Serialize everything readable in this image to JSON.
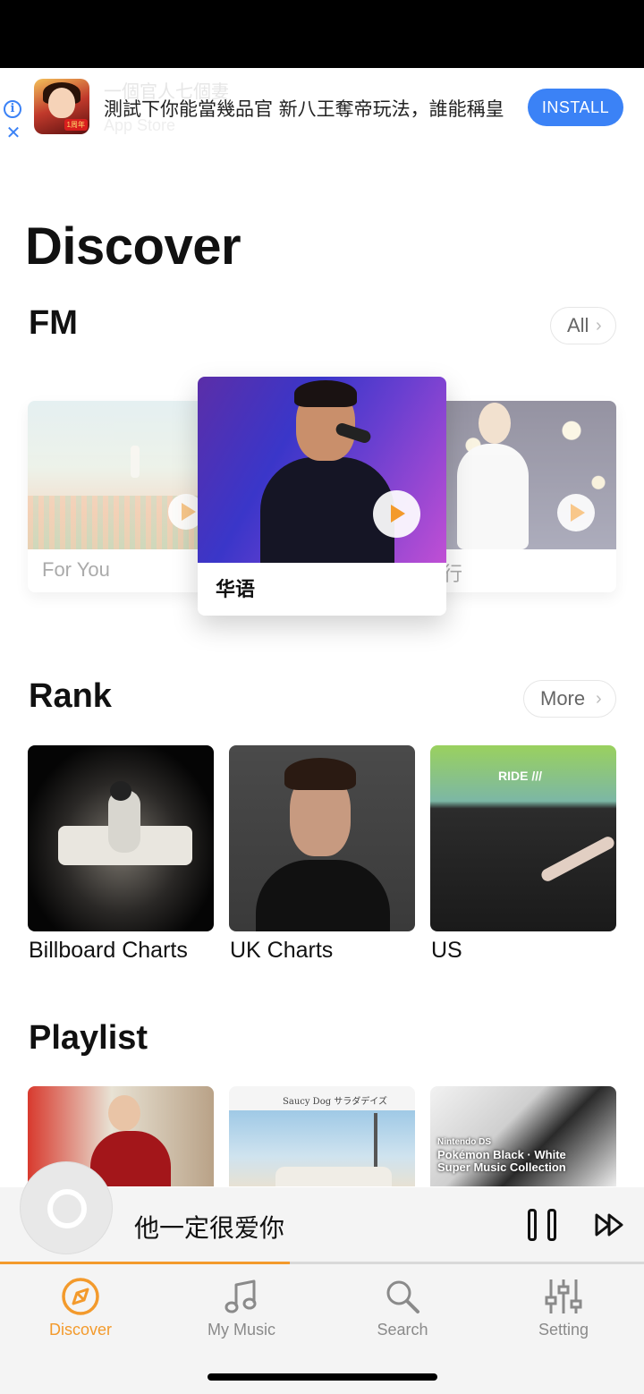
{
  "ad": {
    "ghost_title": "一個官人七個妻",
    "ghost_sub": "App Store",
    "text": "測試下你能當幾品官 新八王奪帝玩法，誰能稱皇",
    "install_label": "INSTALL",
    "thumb_tag": "1周年",
    "info_glyph": "i",
    "close_glyph": "✕"
  },
  "page": {
    "title": "Discover"
  },
  "fm": {
    "title": "FM",
    "all_label": "All",
    "cards": [
      {
        "label": "For You"
      },
      {
        "label": "华语"
      },
      {
        "label": "行"
      }
    ]
  },
  "rank": {
    "title": "Rank",
    "more_label": "More",
    "items": [
      {
        "label": "Billboard Charts"
      },
      {
        "label": "UK Charts"
      },
      {
        "label": "US"
      }
    ],
    "us_cover_title": "RIDE ///"
  },
  "playlist": {
    "title": "Playlist",
    "covers": [
      {
        "caption": ""
      },
      {
        "caption": "Saucy Dog  サラダデイズ"
      },
      {
        "caption_line1": "Nintendo DS",
        "caption_line2": "Pokémon Black · White",
        "caption_line3": "Super Music Collection"
      }
    ]
  },
  "player": {
    "title": "他一定很爱你",
    "progress": 0.45
  },
  "tabs": [
    {
      "label": "Discover",
      "icon": "compass-icon",
      "active": true
    },
    {
      "label": "My Music",
      "icon": "music-note-icon",
      "active": false
    },
    {
      "label": "Search",
      "icon": "search-icon",
      "active": false
    },
    {
      "label": "Setting",
      "icon": "sliders-icon",
      "active": false
    }
  ],
  "colors": {
    "accent": "#f39a2c",
    "ad_button": "#3b82f6"
  }
}
